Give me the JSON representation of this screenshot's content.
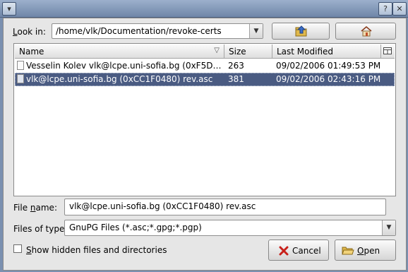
{
  "window": {
    "controls": [
      "help-icon",
      "close-icon"
    ]
  },
  "look_in": {
    "label": "Look in:",
    "path": "/home/vlk/Documentation/revoke-certs",
    "up_icon": "folder-up-icon",
    "home_icon": "home-icon"
  },
  "file_list": {
    "columns": {
      "name": "Name",
      "size": "Size",
      "modified": "Last Modified"
    },
    "sort_indicator": "▽",
    "rows": [
      {
        "name": "Vesselin Kolev vlk@lcpe.uni-sofia.bg (0xF5D…",
        "size": "263",
        "modified": "09/02/2006 01:49:53 PM",
        "selected": false
      },
      {
        "name": "vlk@lcpe.uni-sofia.bg (0xCC1F0480) rev.asc",
        "size": "381",
        "modified": "09/02/2006 02:43:16 PM",
        "selected": true
      }
    ]
  },
  "file_name": {
    "label_prefix": "File ",
    "label_underlined": "n",
    "label_suffix": "ame:",
    "value": "vlk@lcpe.uni-sofia.bg (0xCC1F0480) rev.asc"
  },
  "file_type": {
    "label": "Files of type:",
    "value": "GnuPG Files (*.asc;*.gpg;*.pgp)"
  },
  "show_hidden": {
    "label_underlined": "S",
    "label_rest": "how hidden files and directories",
    "checked": false
  },
  "buttons": {
    "cancel": "Cancel",
    "open_underlined": "O",
    "open_rest": "pen"
  },
  "colors": {
    "selection": "#4a5b82",
    "titlebar": "#7f95b6",
    "dialog_bg": "#e6e6e6"
  }
}
